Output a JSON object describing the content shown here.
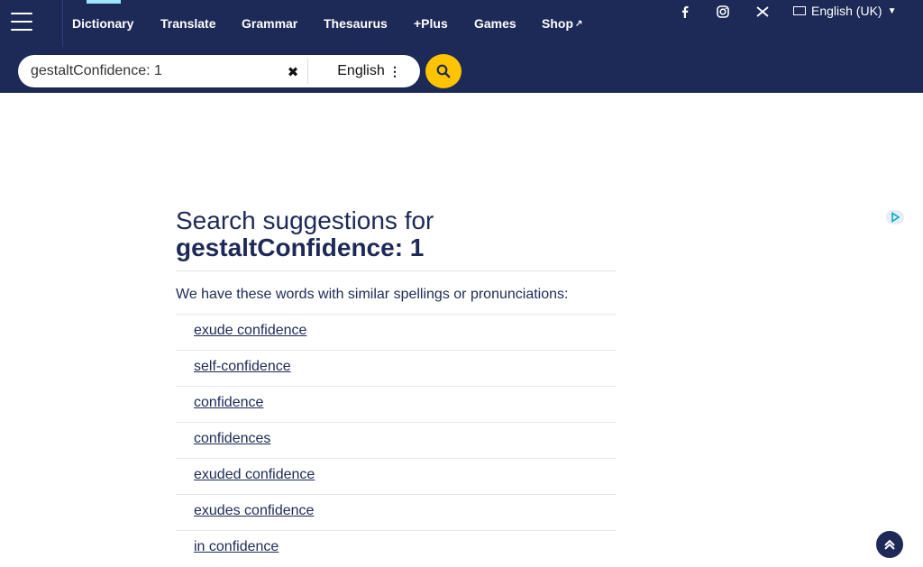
{
  "nav": {
    "items": [
      {
        "label": "Dictionary",
        "active": true
      },
      {
        "label": "Translate"
      },
      {
        "label": "Grammar"
      },
      {
        "label": "Thesaurus"
      },
      {
        "label": "+Plus"
      },
      {
        "label": "Games"
      },
      {
        "label": "Shop",
        "external": true
      }
    ],
    "social_icons": [
      "facebook-icon",
      "instagram-icon",
      "twitter-icon"
    ],
    "site_language": "English (UK)"
  },
  "search": {
    "value": "gestaltConfidence: 1",
    "dictionary": "English"
  },
  "results": {
    "heading_prefix": "Search suggestions for",
    "query": "gestaltConfidence: 1",
    "intro": "We have these words with similar spellings or pronunciations:",
    "suggestions": [
      "exude confidence",
      "self-confidence",
      "confidence",
      "confidences",
      "exuded confidence",
      "exudes confidence",
      "in confidence"
    ]
  },
  "colors": {
    "brand_navy": "#1d2a57",
    "accent_yellow": "#fec400",
    "active_tab": "#9ee4fa"
  }
}
